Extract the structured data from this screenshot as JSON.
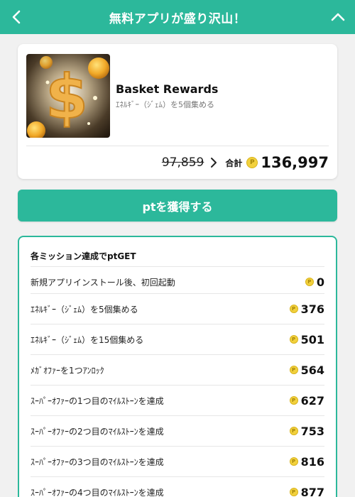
{
  "header": {
    "title": "無料アプリが盛り沢山！",
    "back_icon": "chevron-left-icon",
    "collapse_icon": "chevron-up-icon"
  },
  "colors": {
    "accent": "#2cb89b",
    "coin": "#f2d13d",
    "background": "#f1f1f1"
  },
  "app": {
    "icon": "dollar-coins-icon",
    "name": "Basket Rewards",
    "description": "ｴﾈﾙｷﾞｰ（ｼﾞｪﾑ）を5個集める",
    "old_points": "97,859",
    "total_label": "合計",
    "coin_symbol": "P",
    "total_points": "136,997"
  },
  "cta": {
    "label": "ptを獲得する"
  },
  "missions": {
    "title": "各ミッション達成でptGET",
    "coin_symbol": "P",
    "items": [
      {
        "label": "新規アプリインストール後、初回起動",
        "points": "0"
      },
      {
        "label": "ｴﾈﾙｷﾞｰ（ｼﾞｪﾑ）を5個集める",
        "points": "376"
      },
      {
        "label": "ｴﾈﾙｷﾞｰ（ｼﾞｪﾑ）を15個集める",
        "points": "501"
      },
      {
        "label": "ﾒｶﾞｵﾌｧｰを1つｱﾝﾛｯｸ",
        "points": "564"
      },
      {
        "label": "ｽｰﾊﾟｰｵﾌｧｰの1つ目のﾏｲﾙｽﾄｰﾝを達成",
        "points": "627"
      },
      {
        "label": "ｽｰﾊﾟｰｵﾌｧｰの2つ目のﾏｲﾙｽﾄｰﾝを達成",
        "points": "753"
      },
      {
        "label": "ｽｰﾊﾟｰｵﾌｧｰの3つ目のﾏｲﾙｽﾄｰﾝを達成",
        "points": "816"
      },
      {
        "label": "ｽｰﾊﾟｰｵﾌｧｰの4つ目のﾏｲﾙｽﾄｰﾝを達成",
        "points": "877"
      }
    ]
  }
}
